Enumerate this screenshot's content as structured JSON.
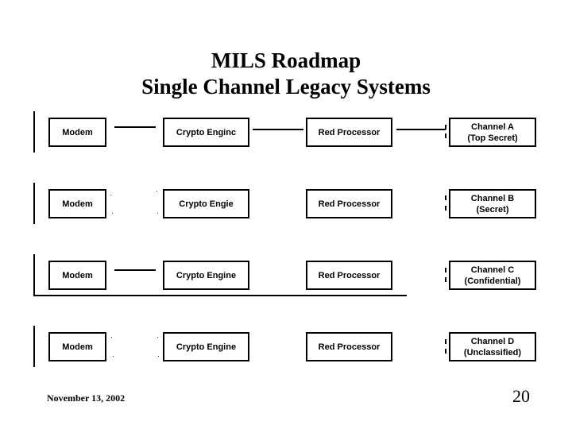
{
  "slide": {
    "title_line1": "MILS Roadmap",
    "title_line2": "Single Channel Legacy Systems",
    "footer_date": "November 13, 2002",
    "page_number": "20"
  },
  "rows": [
    {
      "modem": "Modem",
      "crypto": "Crypto Enginc",
      "processor": "Red Processor",
      "channel_line1": "Channel A",
      "channel_line2": "(Top Secret)",
      "connected": true
    },
    {
      "modem": "Modem",
      "crypto": "Crypto Engie",
      "processor": "Red Processor",
      "channel_line1": "Channel B",
      "channel_line2": "(Secret)",
      "connected": false
    },
    {
      "modem": "Modem",
      "crypto": "Crypto Engine",
      "processor": "Red Processor",
      "channel_line1": "Channel C",
      "channel_line2": "(Confidential)",
      "connected": "partial"
    },
    {
      "modem": "Modem",
      "crypto": "Crypto Engine",
      "processor": "Red Processor",
      "channel_line1": "Channel D",
      "channel_line2": "(Unclassified)",
      "connected": false
    }
  ]
}
